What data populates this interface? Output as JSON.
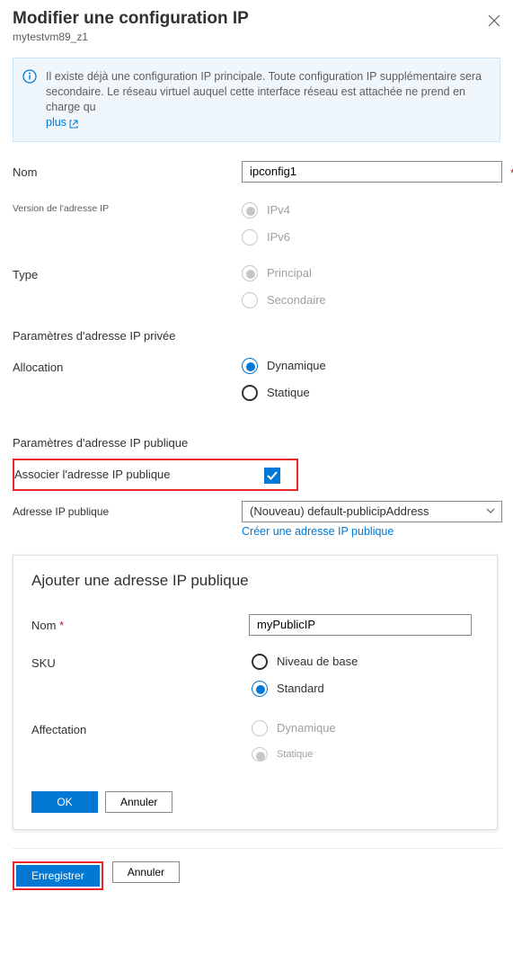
{
  "header": {
    "title": "Modifier une configuration IP",
    "subtitle": "mytestvm89_z1"
  },
  "infobox": {
    "text": "Il existe déjà une configuration IP principale. Toute configuration IP supplémentaire sera secondaire. Le réseau virtuel auquel cette interface réseau est attachée ne prend en charge qu",
    "linkText": "plus"
  },
  "name": {
    "label": "Nom",
    "value": "ipconfig1"
  },
  "ipVersion": {
    "label": "Version de l'adresse IP",
    "options": {
      "ipv4": "IPv4",
      "ipv6": "IPv6"
    },
    "selected": "ipv4"
  },
  "type": {
    "label": "Type",
    "options": {
      "principal": "Principal",
      "secondaire": "Secondaire"
    },
    "selected": "principal"
  },
  "privateHeader": "Paramètres d'adresse IP privée",
  "allocation": {
    "label": "Allocation",
    "options": {
      "dyn": "Dynamique",
      "stat": "Statique"
    },
    "selected": "dyn"
  },
  "publicHeader": "Paramètres d'adresse IP publique",
  "associate": {
    "label": "Associer l'adresse IP publique",
    "checked": true
  },
  "publicAddress": {
    "label": "Adresse IP publique",
    "selected": "(Nouveau) default-publicipAddress",
    "createLink": "Créer une adresse IP publique"
  },
  "createPanel": {
    "title": "Ajouter une adresse IP publique",
    "name": {
      "label": "Nom",
      "value": "myPublicIP"
    },
    "sku": {
      "label": "SKU",
      "options": {
        "basic": "Niveau de base",
        "standard": "Standard"
      },
      "selected": "standard"
    },
    "assignment": {
      "label": "Affectation",
      "options": {
        "dyn": "Dynamique",
        "stat": "Statique"
      }
    },
    "buttons": {
      "ok": "OK",
      "cancel": "Annuler"
    }
  },
  "footer": {
    "save": "Enregistrer",
    "cancel": "Annuler"
  }
}
